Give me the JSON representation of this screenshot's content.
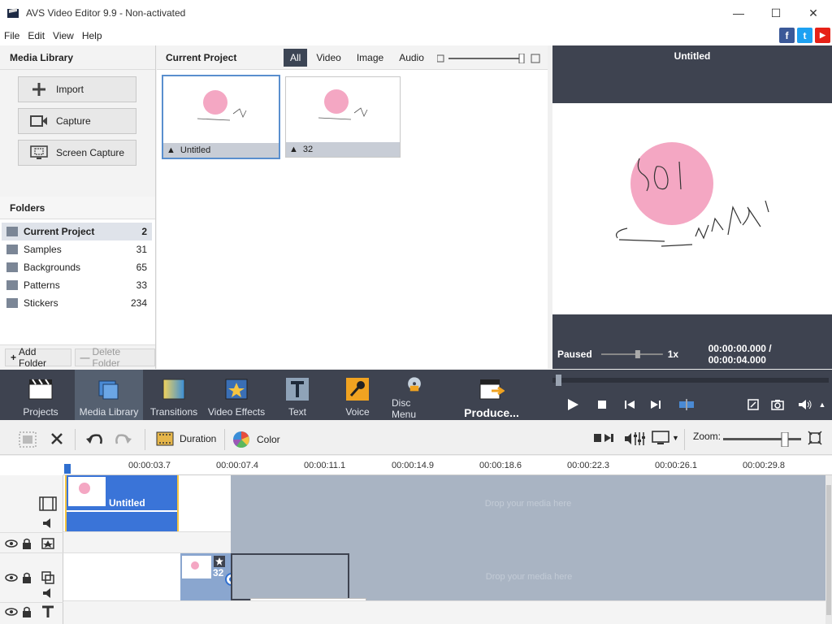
{
  "window": {
    "title": "AVS Video Editor 9.9 - Non-activated"
  },
  "menu": [
    "File",
    "Edit",
    "View",
    "Help"
  ],
  "social": {
    "facebook": "f",
    "twitter": "t",
    "youtube": "▶"
  },
  "media_library": {
    "title": "Media Library",
    "buttons": {
      "import": "Import",
      "capture": "Capture",
      "screen_capture": "Screen Capture"
    },
    "folders_title": "Folders",
    "folders": [
      {
        "name": "Current Project",
        "count": "2"
      },
      {
        "name": "Samples",
        "count": "31"
      },
      {
        "name": "Backgrounds",
        "count": "65"
      },
      {
        "name": "Patterns",
        "count": "33"
      },
      {
        "name": "Stickers",
        "count": "234"
      }
    ],
    "add_folder": "Add Folder",
    "delete_folder": "Delete Folder"
  },
  "current_project": {
    "title": "Current Project",
    "filters": [
      "All",
      "Video",
      "Image",
      "Audio"
    ],
    "items": [
      {
        "name": "Untitled"
      },
      {
        "name": "32"
      }
    ]
  },
  "preview": {
    "title": "Untitled",
    "state": "Paused",
    "speed": "1x",
    "time": "00:00:00.000 / 00:00:04.000",
    "drawing_text": "SOI ————— LLAR"
  },
  "toolbar": {
    "projects": "Projects",
    "media_library": "Media Library",
    "transitions": "Transitions",
    "video_effects": "Video Effects",
    "text": "Text",
    "voice": "Voice",
    "disc_menu": "Disc Menu",
    "produce": "Produce..."
  },
  "edit_toolbar": {
    "duration": "Duration",
    "color": "Color",
    "zoom": "Zoom:"
  },
  "timeline": {
    "ticks": [
      "00:00:03.7",
      "00:00:07.4",
      "00:00:11.1",
      "00:00:14.9",
      "00:00:18.6",
      "00:00:22.3",
      "00:00:26.1",
      "00:00:29.8"
    ],
    "clip1_label": "Untitled",
    "clip2_label": "32",
    "drop_text_1": "Drop your media here",
    "drop_text_2": "Drop your media here"
  }
}
